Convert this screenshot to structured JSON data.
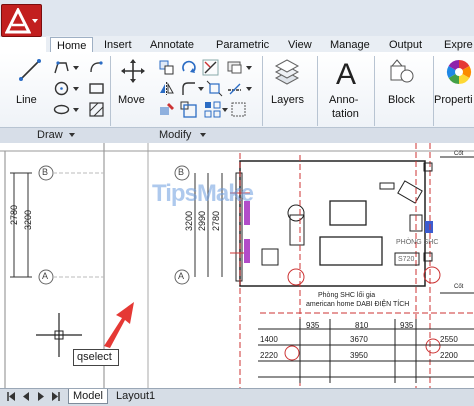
{
  "app": {
    "menu_icon": "autocad-logo-icon"
  },
  "tabs": [
    {
      "label": "Home",
      "active": true
    },
    {
      "label": "Insert"
    },
    {
      "label": "Annotate"
    },
    {
      "label": "Parametric"
    },
    {
      "label": "View"
    },
    {
      "label": "Manage"
    },
    {
      "label": "Output"
    },
    {
      "label": "Expre"
    }
  ],
  "ribbon": {
    "draw": {
      "panel_label": "Draw",
      "line_label": "Line",
      "icons": [
        "line-icon",
        "polyline-icon",
        "circle-icon",
        "arc-icon",
        "rectangle-icon",
        "hatch-icon",
        "ellipse-icon",
        "boundary-icon"
      ]
    },
    "modify": {
      "panel_label": "Modify",
      "move_label": "Move",
      "icons": [
        "move-icon",
        "copy-icon",
        "rotate-icon",
        "mirror-icon",
        "stretch-icon",
        "scale-icon",
        "trim-icon",
        "fillet-icon",
        "array-icon",
        "erase-icon",
        "explode-icon",
        "offset-icon"
      ]
    },
    "layers_label": "Layers",
    "annotation_label": "Anno-\ntation",
    "annotation_line1": "Anno-",
    "annotation_line2": "tation",
    "block_label": "Block",
    "properties_label": "Properti"
  },
  "drawing": {
    "dims_left": [
      "2780",
      "3200"
    ],
    "dims_mid": [
      "3200",
      "2990",
      "2780"
    ],
    "grid_bubbles": [
      "B",
      "A",
      "B",
      "A"
    ],
    "room_label": "PHÒNG SHC",
    "room_area": "S720",
    "room_note_line1": "Phòng SHC lối gia",
    "room_note_line2": "american home DABI ĐIỆN TÍCH",
    "bottom_dims_row1": [
      "935",
      "810",
      "935"
    ],
    "bottom_dims_row2": [
      "1400",
      "3670",
      "2550"
    ],
    "bottom_dims_row3": [
      "2220",
      "3950",
      "2200"
    ],
    "watermark": "TipsMake",
    "right_tags": [
      "Cốt",
      "Cốt"
    ]
  },
  "command": {
    "value": "qselect"
  },
  "layout_tabs": [
    {
      "label": "Model",
      "active": true
    },
    {
      "label": "Layout1"
    }
  ]
}
